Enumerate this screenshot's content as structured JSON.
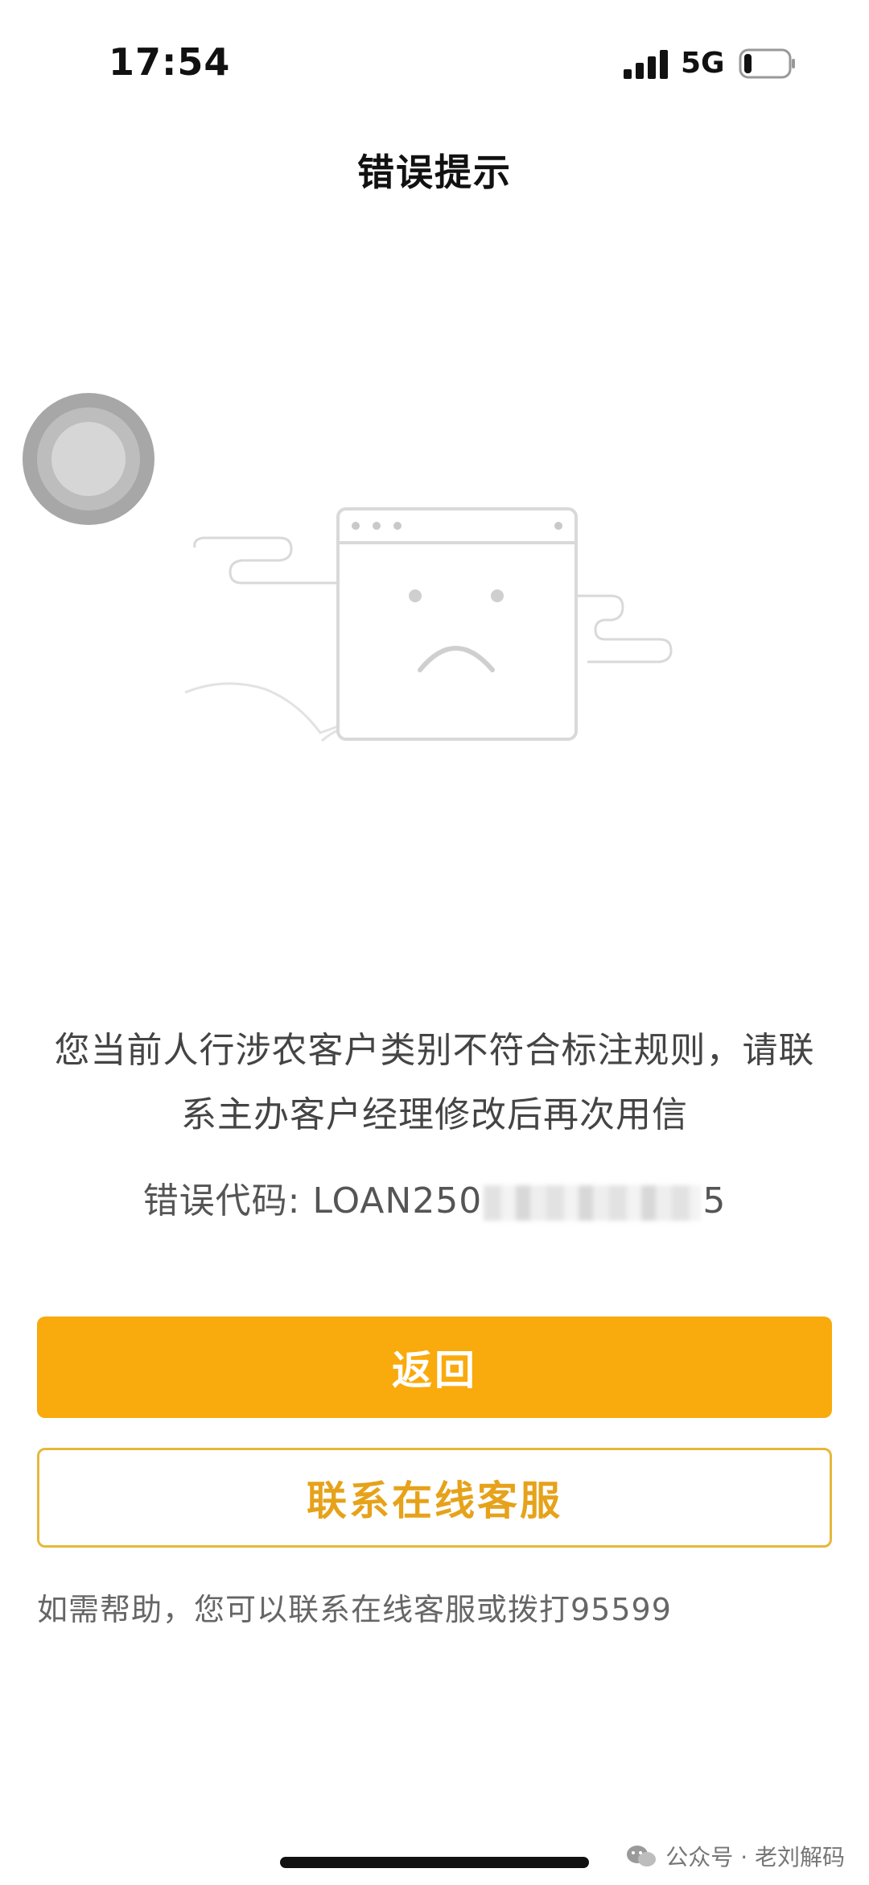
{
  "status_bar": {
    "time": "17:54",
    "network": "5G",
    "icons": [
      "signal-icon",
      "battery-icon"
    ]
  },
  "nav": {
    "title": "错误提示"
  },
  "illustration": {
    "icon": "sad-browser-illustration"
  },
  "error": {
    "message": "您当前人行涉农客户类别不符合标注规则，请联系主办客户经理修改后再次用信",
    "code_label": "错误代码: LOAN250",
    "code_tail": "5"
  },
  "buttons": {
    "back_label": "返回",
    "service_label": "联系在线客服"
  },
  "help": {
    "text": "如需帮助，您可以联系在线客服或拨打95599"
  },
  "watermark": {
    "text": "公众号 · 老刘解码"
  },
  "colors": {
    "accent": "#f9aa0c",
    "outline": "#e6b83a",
    "text": "#444444"
  }
}
